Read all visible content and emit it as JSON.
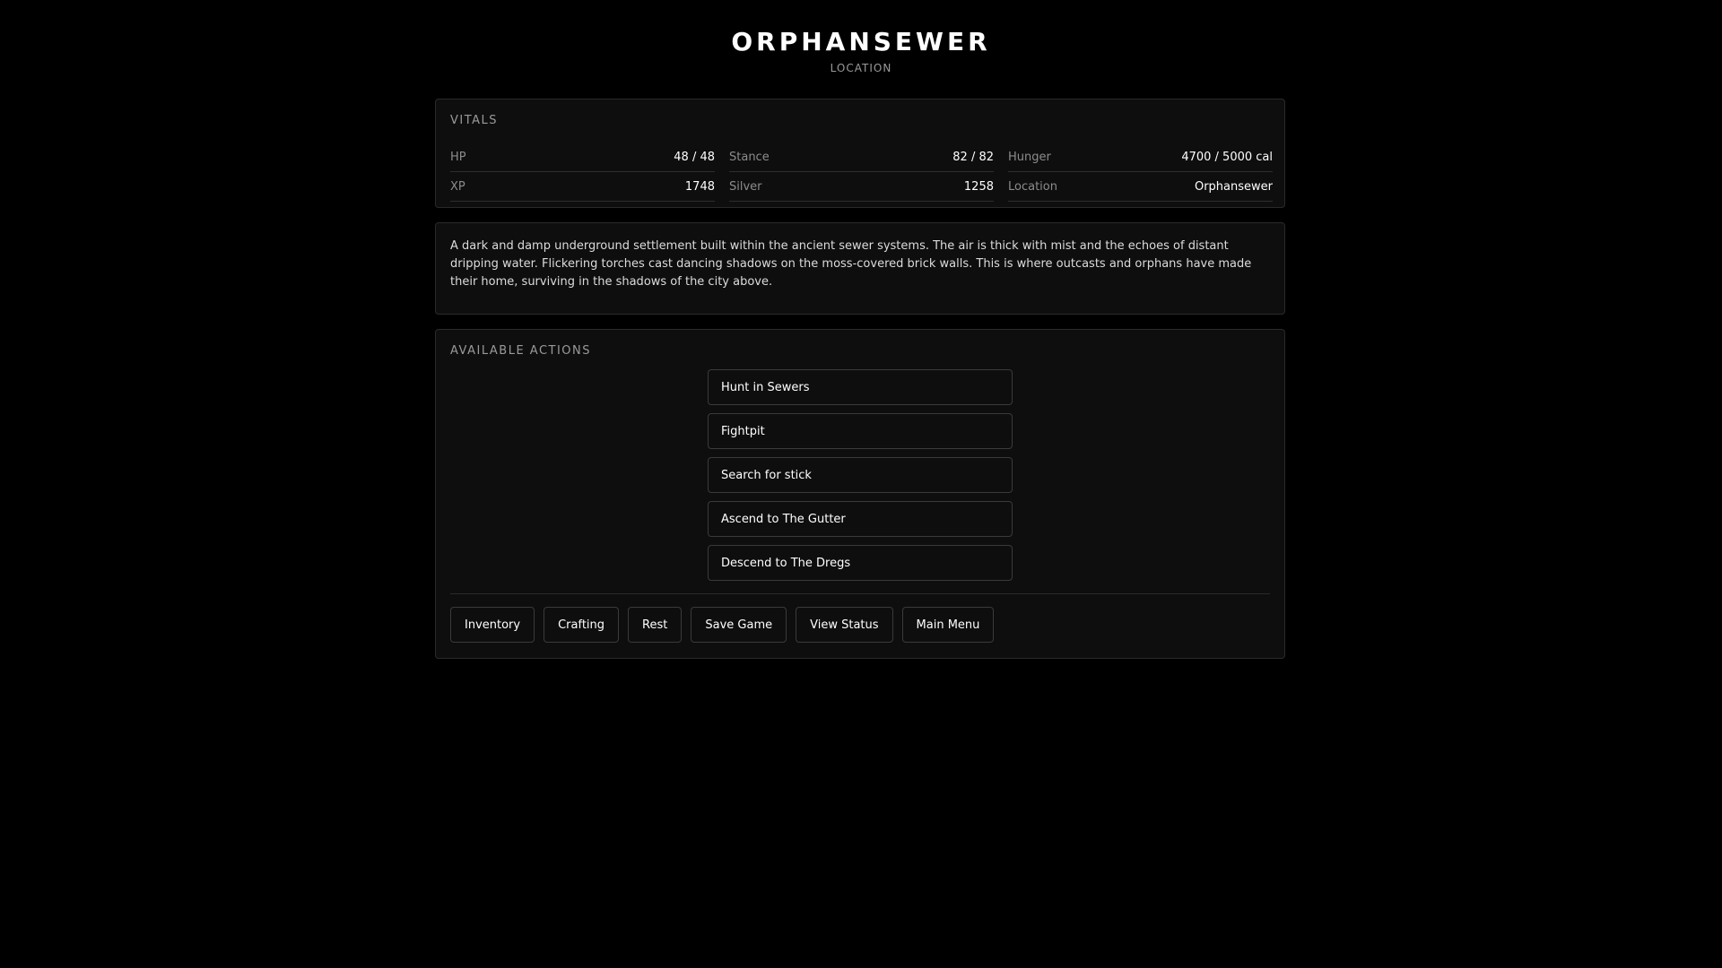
{
  "header": {
    "title": "ORPHANSEWER",
    "subtitle": "LOCATION"
  },
  "vitals": {
    "label": "VITALS",
    "stats": [
      {
        "label": "HP",
        "value": "48 / 48"
      },
      {
        "label": "Stance",
        "value": "82 / 82"
      },
      {
        "label": "Hunger",
        "value": "4700 / 5000 cal"
      },
      {
        "label": "XP",
        "value": "1748"
      },
      {
        "label": "Silver",
        "value": "1258"
      },
      {
        "label": "Location",
        "value": "Orphansewer"
      }
    ]
  },
  "description": {
    "text": "A dark and damp underground settlement built within the ancient sewer systems. The air is thick with mist and the echoes of distant dripping water. Flickering torches cast dancing shadows on the moss-covered brick walls. This is where outcasts and orphans have made their home, surviving in the shadows of the city above."
  },
  "actions": {
    "label": "AVAILABLE ACTIONS",
    "items": [
      {
        "label": "Hunt in Sewers"
      },
      {
        "label": "Fightpit"
      },
      {
        "label": "Search for stick"
      },
      {
        "label": "Ascend to The Gutter"
      },
      {
        "label": "Descend to The Dregs"
      }
    ]
  },
  "menu": {
    "items": [
      {
        "label": "Inventory"
      },
      {
        "label": "Crafting"
      },
      {
        "label": "Rest"
      },
      {
        "label": "Save Game"
      },
      {
        "label": "View Status"
      },
      {
        "label": "Main Menu"
      }
    ]
  },
  "colors": {
    "background": "#000000",
    "panel": "#0e0e0e",
    "border": "#2a2a2a",
    "text": "#ffffff",
    "muted": "#9a9a9a"
  }
}
